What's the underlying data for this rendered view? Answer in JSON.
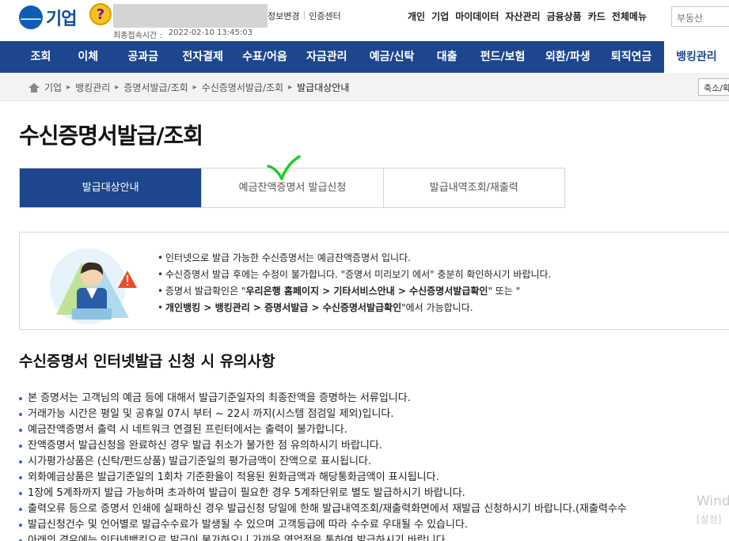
{
  "header": {
    "logo_text": "기업",
    "help_icon": "?",
    "top_links": [
      "정보변경",
      "인증센터"
    ],
    "last_login_label": "최종접속시간 :",
    "last_login_value": "2022-02-10 13:45:03",
    "util_menu": [
      "개인",
      "기업",
      "마이데이터",
      "자산관리",
      "금융상품",
      "카드",
      "전체메뉴"
    ],
    "search_placeholder": "부동산"
  },
  "nav": {
    "items": [
      "조회",
      "이체",
      "공과금",
      "전자결제",
      "수표/어음",
      "자금관리",
      "예금/신탁",
      "대출",
      "펀드/보험",
      "외환/파생",
      "퇴직연금",
      "뱅킹관리"
    ],
    "active_index": 11
  },
  "breadcrumb": {
    "items": [
      "기업",
      "뱅킹관리",
      "증명서발급/조회",
      "수신증명서발급/조회",
      "발급대상안내"
    ],
    "zoom_label": "축소/확"
  },
  "page": {
    "title": "수신증명서발급/조회"
  },
  "tabs": {
    "items": [
      "발급대상안내",
      "예금잔액증명서 발급신청",
      "발급내역조회/재출력"
    ],
    "active_index": 0
  },
  "info": {
    "line1": "인터넷으로 발급 가능한 수신증명서는 예금잔액증명서 입니다.",
    "line2": "수신증명서 발급 후에는 수정이 불가합니다. \"증명서 미리보기 에서\" 충분히 확인하시기 바랍니다.",
    "line3_pre": "증명서 발급확인은 \"",
    "line3_bold1": "우리은행 홈페이지 > 기타서비스안내 > 수신증명서발급확인",
    "line3_mid": "\" 또는 \"",
    "line4_bold2": "개인뱅킹 > 뱅킹관리 > 증명서발급 > 수신증명서발급확인",
    "line4_post": "\"에서 가능합니다."
  },
  "notice": {
    "title": "수신증명서 인터넷발급 신청 시 유의사항",
    "items": [
      "본 증명서는 고객님의 예금 등에 대해서 발급기준일자의 최종잔액을 증명하는 서류입니다.",
      "거래가능 시간은 평일 및 공휴일 07시 부터 ~ 22시 까지(시스템 점검일 제외)입니다.",
      "예금잔액증명서 출력 시 네트워크 연결된 프린터에서는 출력이 불가합니다.",
      "잔액증명서 발급신청을 완료하신 경우 발급 취소가 불가한 점 유의하시기 바랍니다.",
      "시가평가상품은 (신탁/펀드상품) 발급기준일의 평가금액이 잔액으로 표시됩니다.",
      "외화예금상품은 발급기준일의 1회차 기준환율이 적용된 원화금액과 해당통화금액이 표시됩니다.",
      "1장에 5계좌까지 발급 가능하며 초과하여 발급이 필요한 경우 5계좌단위로 별도 발급하시기 바랍니다.",
      "출력오류 등으로 증명서 인쇄에 실패하신 경우 발급신청 당일에 한해 발급내역조회/재출력화면에서 재발급 신청하시기 바랍니다.(재출력수수",
      "발급신청건수 및 언어별로 발급수수료가 발생될 수 있으며 고객등급에 따라 수수료 우대될 수 있습니다.",
      "아래의 경우에는 인터넷뱅킹으로 발급이 불가하오니 가까운 영업점을 통하여 발급하시기 바랍니다."
    ]
  },
  "os_watermark": {
    "line1": "Wind",
    "line2": "[설정]"
  },
  "colors": {
    "nav_bg": "#1d468f",
    "accent": "#1d468f",
    "check_mark": "#22cc22"
  }
}
